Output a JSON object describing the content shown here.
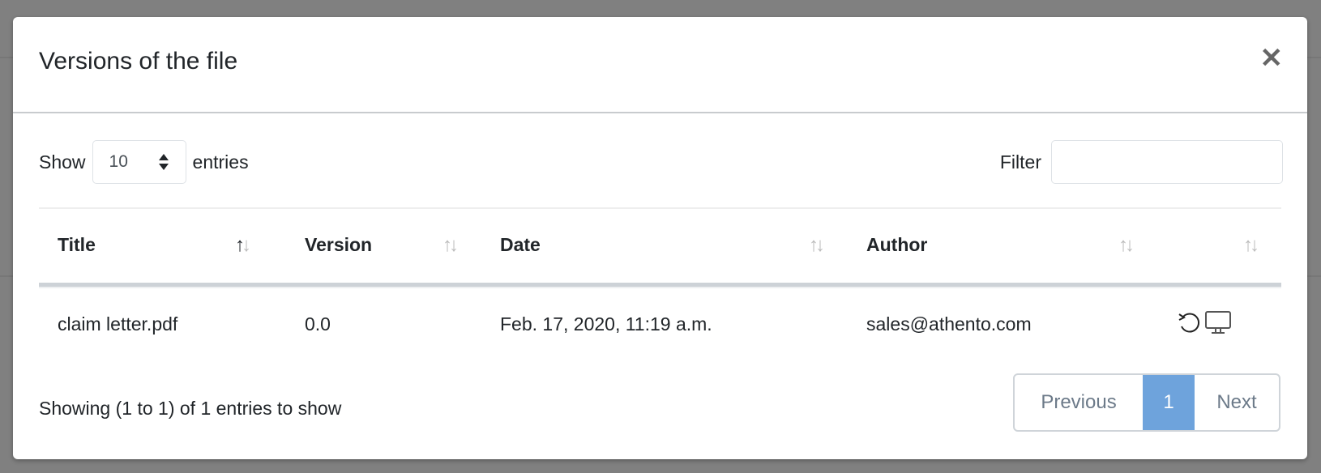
{
  "modal": {
    "title": "Versions of the file",
    "close_icon": "close-icon"
  },
  "controls": {
    "show_label": "Show",
    "page_size": "10",
    "entries_label": "entries",
    "filter_label": "Filter",
    "filter_value": ""
  },
  "table": {
    "columns": [
      "Title",
      "Version",
      "Date",
      "Author",
      ""
    ],
    "sorted_column": "Title",
    "rows": [
      {
        "title": "claim letter.pdf",
        "version": "0.0",
        "date": "Feb. 17, 2020, 11:19 a.m.",
        "author": "sales@athento.com",
        "actions": [
          "restore-icon",
          "monitor-icon"
        ]
      }
    ]
  },
  "footer": {
    "info": "Showing (1 to 1) of 1 entries to show",
    "previous": "Previous",
    "current_page": "1",
    "next": "Next",
    "accent": "#6ea3dc"
  }
}
